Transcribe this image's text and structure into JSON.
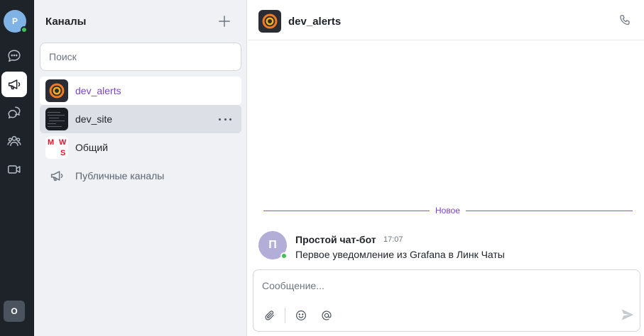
{
  "rail": {
    "profile_initial": "Р",
    "user_initial": "О",
    "items": [
      {
        "name": "chats",
        "icon": "chat-bubble-icon"
      },
      {
        "name": "channels",
        "icon": "megaphone-icon",
        "active": true
      },
      {
        "name": "threads",
        "icon": "threads-icon"
      },
      {
        "name": "contacts",
        "icon": "people-icon"
      },
      {
        "name": "calls",
        "icon": "video-camera-icon"
      }
    ]
  },
  "sidebar": {
    "title": "Каналы",
    "search_placeholder": "Поиск",
    "channels": [
      {
        "name": "dev_alerts",
        "icon": "grafana-logo-icon",
        "state": "selected"
      },
      {
        "name": "dev_site",
        "icon": "code-screenshot-icon",
        "state": "hover"
      },
      {
        "name": "Общий",
        "icon": "mws-logo-icon",
        "state": "normal"
      },
      {
        "name": "Публичные каналы",
        "icon": "megaphone-icon",
        "state": "public"
      }
    ],
    "mws_logo": {
      "m": "M",
      "w": "W",
      "s": "S"
    }
  },
  "chat": {
    "title": "dev_alerts",
    "divider_label": "Новое",
    "messages": [
      {
        "avatar_initial": "П",
        "author": "Простой чат-бот",
        "time": "17:07",
        "text": "Первое уведомление из Grafana в Линк Чаты"
      }
    ],
    "composer_placeholder": "Сообщение..."
  },
  "colors": {
    "rail_bg": "#1e2229",
    "sidebar_bg": "#eff1f4",
    "accent": "#7b45c9",
    "online": "#3fbf57",
    "grafana_orange": "#f57a22",
    "mws_red": "#e3142d"
  }
}
